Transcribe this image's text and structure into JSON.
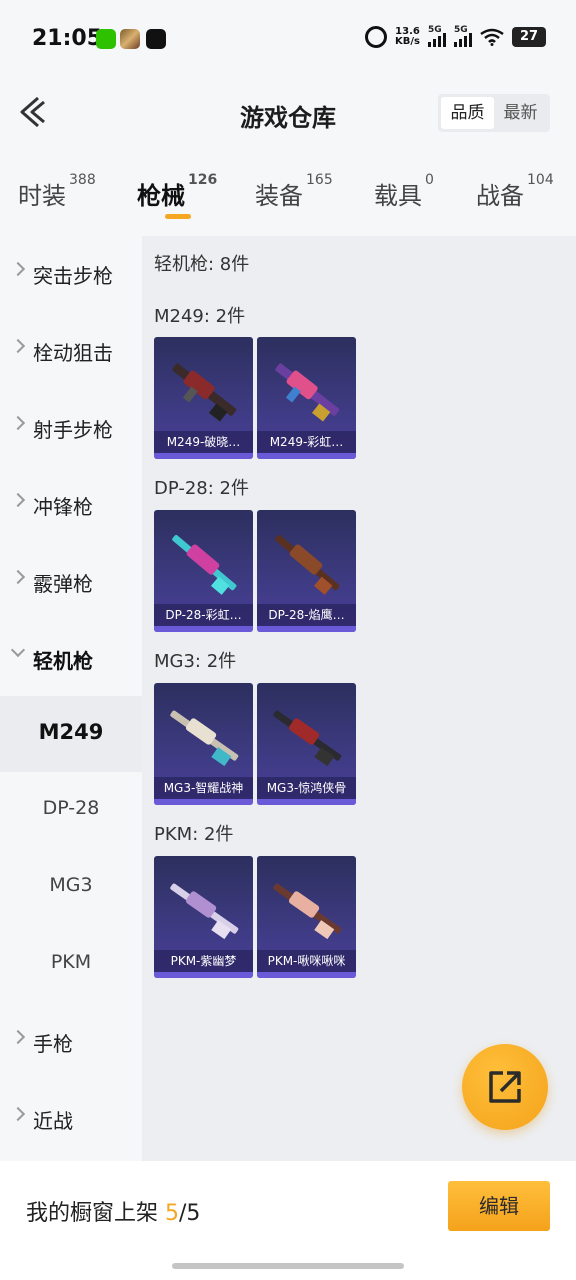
{
  "status_bar": {
    "time": "21:05",
    "net_speed_value": "13.6",
    "net_speed_unit": "KB/s",
    "signal1_label": "5G",
    "signal2_label": "5G",
    "battery": "27",
    "icons": [
      "wechat-icon",
      "game-app-icon",
      "app-icon",
      "alarm-icon",
      "signal-icon",
      "signal-icon",
      "wifi-icon",
      "battery-icon"
    ]
  },
  "header": {
    "title": "游戏仓库",
    "sort_options": [
      "品质",
      "最新"
    ],
    "sort_active": "品质"
  },
  "tabs": [
    {
      "label": "时装",
      "count": "388"
    },
    {
      "label": "枪械",
      "count": "126"
    },
    {
      "label": "装备",
      "count": "165"
    },
    {
      "label": "载具",
      "count": "0"
    },
    {
      "label": "战备",
      "count": "104"
    }
  ],
  "active_tab": "枪械",
  "sidebar": {
    "items": [
      {
        "label": "突击步枪"
      },
      {
        "label": "栓动狙击"
      },
      {
        "label": "射手步枪"
      },
      {
        "label": "冲锋枪"
      },
      {
        "label": "霰弹枪"
      },
      {
        "label": "轻机枪"
      },
      {
        "label": "M249"
      },
      {
        "label": "DP-28"
      },
      {
        "label": "MG3"
      },
      {
        "label": "PKM"
      },
      {
        "label": "手枪"
      },
      {
        "label": "近战"
      }
    ],
    "selected": "M249"
  },
  "content": {
    "summary": "轻机枪: 8件",
    "groups": [
      {
        "header": "M249: 2件",
        "items": [
          "M249-破晓…",
          "M249-彩虹…"
        ]
      },
      {
        "header": "DP-28: 2件",
        "items": [
          "DP-28-彩虹…",
          "DP-28-焰鹰…"
        ]
      },
      {
        "header": "MG3: 2件",
        "items": [
          "MG3-智耀战神",
          "MG3-惊鸿侠骨"
        ]
      },
      {
        "header": "PKM: 2件",
        "items": [
          "PKM-紫幽梦",
          "PKM-啾咪啾咪"
        ]
      }
    ]
  },
  "bottom_bar": {
    "shelf_label": "我的橱窗上架",
    "shelf_current": "5",
    "shelf_total": "/5",
    "edit_label": "编辑"
  },
  "colors": {
    "accent": "#f5a623",
    "card_bg": "#3d3a80"
  }
}
